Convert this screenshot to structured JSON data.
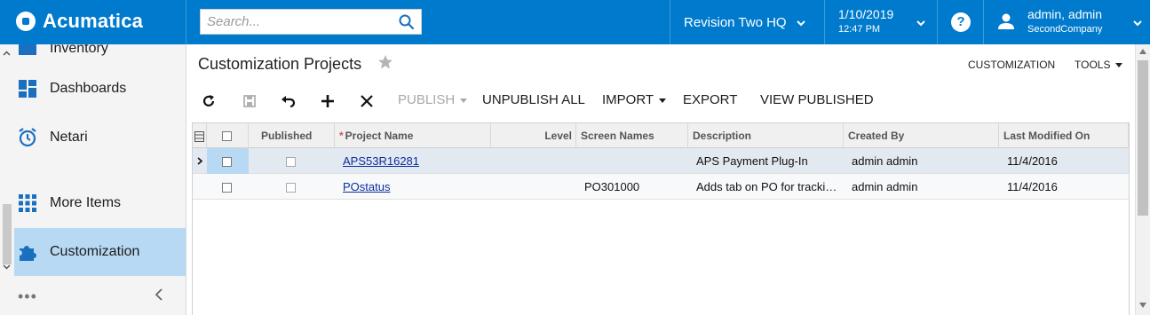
{
  "brand": {
    "name": "Acumatica",
    "color": "#007acc"
  },
  "search": {
    "placeholder": "Search..."
  },
  "branch": {
    "label": "Revision Two HQ"
  },
  "datetime": {
    "date": "1/10/2019",
    "time": "12:47 PM"
  },
  "help": {
    "label": "?"
  },
  "user": {
    "name": "admin, admin",
    "company": "SecondCompany"
  },
  "sidebar": {
    "items": [
      {
        "label": "Inventory",
        "icon": "inventory-icon"
      },
      {
        "label": "Dashboards",
        "icon": "dashboards-icon"
      },
      {
        "label": "Netari",
        "icon": "alarm-clock-icon"
      },
      {
        "label": "More Items",
        "icon": "grid-icon"
      },
      {
        "label": "Customization",
        "icon": "puzzle-icon",
        "active": true
      }
    ],
    "more_dots": "•••"
  },
  "page": {
    "title": "Customization Projects",
    "links": {
      "customization": "CUSTOMIZATION",
      "tools": "TOOLS"
    }
  },
  "toolbar": {
    "publish": "PUBLISH",
    "unpublish_all": "UNPUBLISH ALL",
    "import": "IMPORT",
    "export": "EXPORT",
    "view_published": "VIEW PUBLISHED"
  },
  "grid": {
    "columns": {
      "published": "Published",
      "project_name": "Project Name",
      "level": "Level",
      "screen_names": "Screen Names",
      "description": "Description",
      "created_by": "Created By",
      "last_modified_on": "Last Modified On"
    },
    "required_mark": "*",
    "rows": [
      {
        "project_name": "APS53R16281",
        "level": "",
        "screen_names": "",
        "description": "APS Payment Plug-In",
        "created_by": "admin admin",
        "last_modified_on": "11/4/2016",
        "selected": true
      },
      {
        "project_name": "POstatus",
        "level": "",
        "screen_names": "PO301000",
        "description": "Adds tab on PO for tracking status",
        "created_by": "admin admin",
        "last_modified_on": "11/4/2016",
        "selected": false
      }
    ]
  }
}
